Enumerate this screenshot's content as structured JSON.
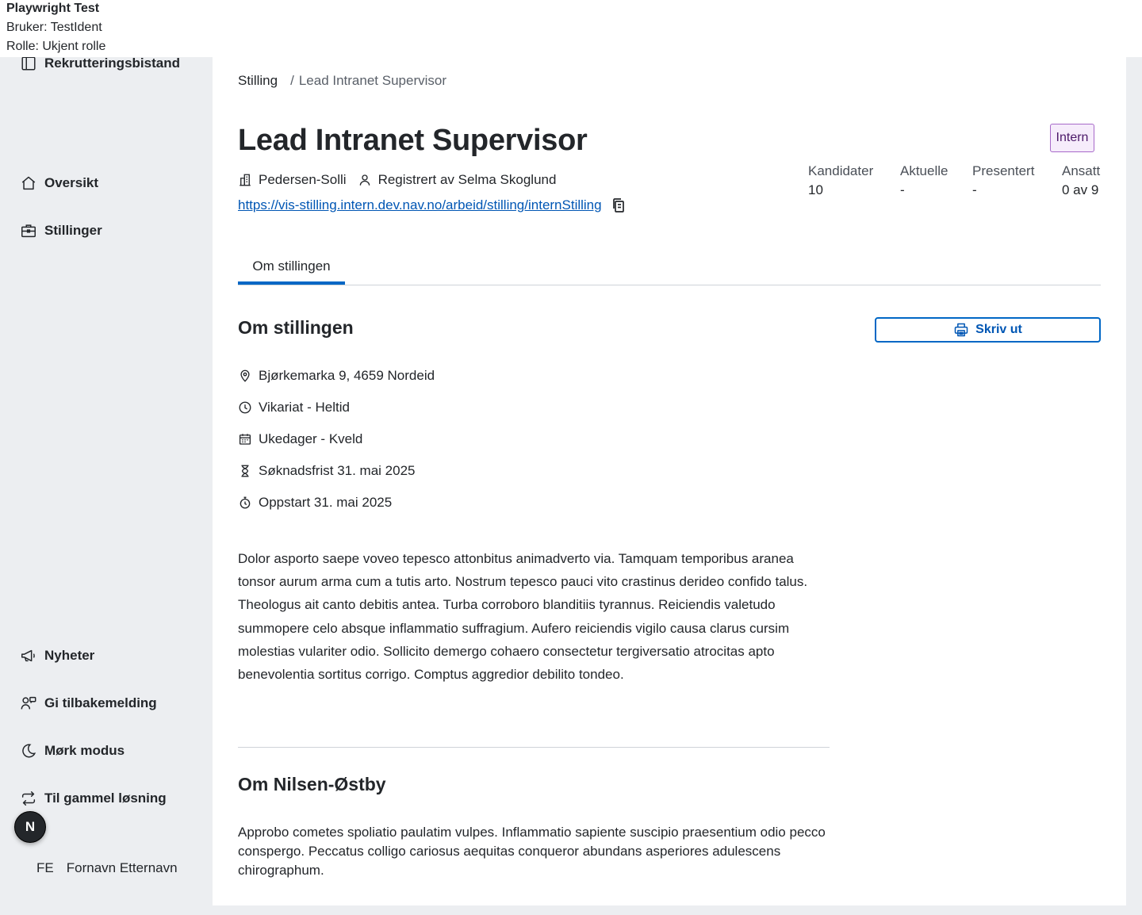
{
  "dev_banner": {
    "title": "Playwright Test",
    "user": "Bruker: TestIdent",
    "role": "Rolle: Ukjent rolle"
  },
  "sidebar": {
    "app_name": "Rekrutteringsbistand",
    "top_items": [
      {
        "label": "Oversikt",
        "icon": "home-icon"
      },
      {
        "label": "Stillinger",
        "icon": "briefcase-icon"
      }
    ],
    "bottom_items": [
      {
        "label": "Nyheter",
        "icon": "megaphone-icon"
      },
      {
        "label": "Gi tilbakemelding",
        "icon": "feedback-icon"
      },
      {
        "label": "Mørk modus",
        "icon": "moon-icon"
      },
      {
        "label": "Til gammel løsning",
        "icon": "arrows-swap-icon"
      }
    ],
    "fab_letter": "N",
    "user_initials": "FE",
    "user_name": "Fornavn Etternavn"
  },
  "breadcrumb": {
    "parent": "Stilling",
    "separator": "/",
    "current": "Lead Intranet Supervisor"
  },
  "job": {
    "title": "Lead Intranet Supervisor",
    "tag": "Intern",
    "employer": "Pedersen-Solli",
    "registered_by": "Registrert av Selma Skoglund",
    "url": "https://vis-stilling.intern.dev.nav.no/arbeid/stilling/internStilling"
  },
  "stats": [
    {
      "label": "Kandidater",
      "value": "10"
    },
    {
      "label": "Aktuelle",
      "value": "-"
    },
    {
      "label": "Presentert",
      "value": "-"
    },
    {
      "label": "Ansatt",
      "value": "0 av 9"
    }
  ],
  "tabs": [
    {
      "label": "Om stillingen",
      "active": true
    }
  ],
  "about": {
    "heading": "Om stillingen",
    "print_label": "Skriv ut",
    "facts": [
      {
        "icon": "location-pin-icon",
        "text": "Bjørkemarka 9, 4659 Nordeid"
      },
      {
        "icon": "clock-icon",
        "text": "Vikariat - Heltid"
      },
      {
        "icon": "calendar-icon",
        "text": "Ukedager - Kveld"
      },
      {
        "icon": "hourglass-icon",
        "text": "Søknadsfrist 31. mai 2025"
      },
      {
        "icon": "stopwatch-icon",
        "text": "Oppstart 31. mai 2025"
      }
    ],
    "description": "Dolor asporto saepe voveo tepesco attonbitus animadverto via. Tamquam temporibus aranea tonsor aurum arma cum a tutis arto. Nostrum tepesco pauci vito crastinus derideo confido talus. Theologus ait canto debitis antea. Turba corroboro blanditiis tyrannus. Reiciendis valetudo summopere celo absque inflammatio suffragium. Aufero reiciendis vigilo causa clarus cursim molestias vulariter odio. Sollicito demergo cohaero consectetur tergiversatio atrocitas apto benevolentia sortitus corrigo. Comptus aggredior debilito tondeo."
  },
  "employer_section": {
    "heading": "Om Nilsen-Østby",
    "text": "Approbo cometes spoliatio paulatim vulpes. Inflammatio sapiente suscipio praesentium odio pecco conspergo. Peccatus colligo cariosus aequitas conqueror abundans asperiores adulescens chirographum."
  },
  "colors": {
    "accent": "#0067c5",
    "link": "#0056b4",
    "sidebar_bg": "#eceef1",
    "tag_border": "#a769c9",
    "tag_bg": "#f6ecfb"
  }
}
